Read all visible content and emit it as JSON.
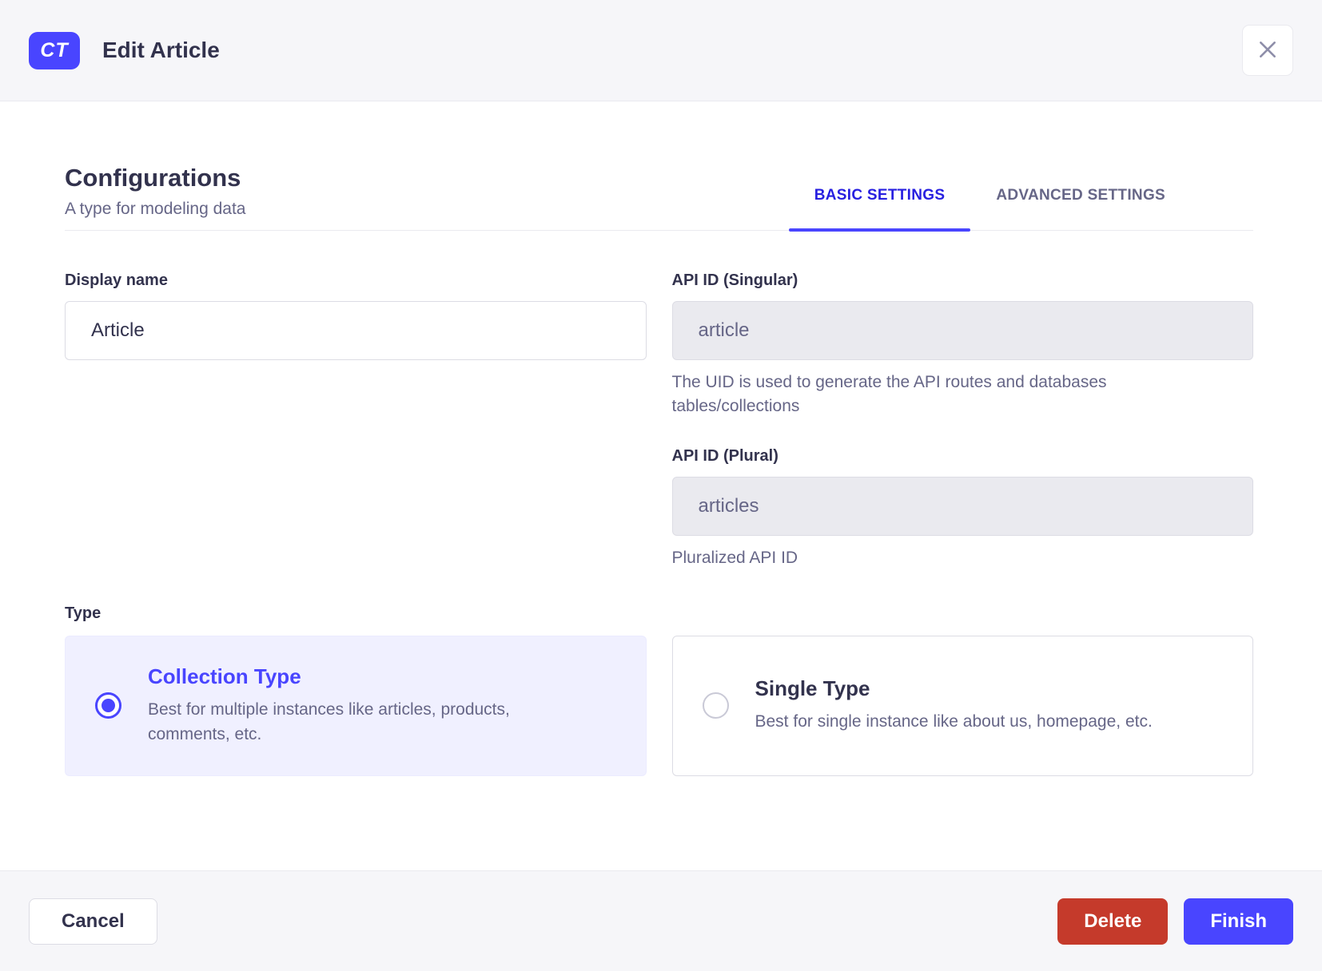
{
  "header": {
    "badge": "CT",
    "title": "Edit Article"
  },
  "section": {
    "title": "Configurations",
    "subtitle": "A type for modeling data",
    "tabs": [
      {
        "label": "BASIC SETTINGS",
        "active": true
      },
      {
        "label": "ADVANCED SETTINGS",
        "active": false
      }
    ]
  },
  "form": {
    "display_name": {
      "label": "Display name",
      "value": "Article"
    },
    "api_id_singular": {
      "label": "API ID (Singular)",
      "value": "article",
      "hint": "The UID is used to generate the API routes and databases tables/collections"
    },
    "api_id_plural": {
      "label": "API ID (Plural)",
      "value": "articles",
      "hint": "Pluralized API ID"
    },
    "type": {
      "label": "Type",
      "options": [
        {
          "title": "Collection Type",
          "description": "Best for multiple instances like articles, products, comments, etc.",
          "selected": true
        },
        {
          "title": "Single Type",
          "description": "Best for single instance like about us, homepage, etc.",
          "selected": false
        }
      ]
    }
  },
  "footer": {
    "cancel_label": "Cancel",
    "delete_label": "Delete",
    "finish_label": "Finish"
  },
  "colors": {
    "primary": "#4945ff",
    "primary_text_active_tab": "#271fe0",
    "danger": "#c53a2b",
    "text_dark": "#32324d",
    "text_muted": "#666687",
    "surface_subtle": "#f6f6f9",
    "selected_card_bg": "#f0f0ff",
    "border": "#dcdce4",
    "divider": "#eaeaef",
    "close_icon": "#8e8ea9"
  }
}
